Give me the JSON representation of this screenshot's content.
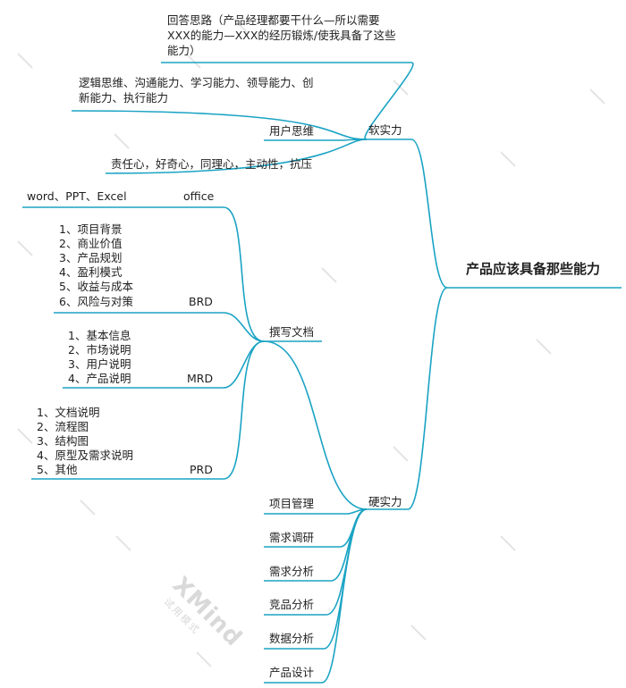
{
  "root": "产品应该具备那些能力",
  "soft": {
    "label": "软实力",
    "approach_lines": [
      "回答思路（产品经理都要干什么—所以需要",
      "XXX的能力—XXX的经历锻炼/使我具备了这些",
      "能力）"
    ],
    "abilities_lines": [
      "逻辑思维、沟通能力、学习能力、领导能力、创",
      "新能力、执行能力"
    ],
    "user_thinking": "用户思维",
    "traits": "责任心，好奇心，同理心，主动性，抗压"
  },
  "hard": {
    "label": "硬实力",
    "writing": {
      "label": "撰写文档",
      "office": {
        "label": "office",
        "items": [
          "word、PPT、Excel"
        ]
      },
      "brd": {
        "label": "BRD",
        "items": [
          "1、项目背景",
          "2、商业价值",
          "3、产品规划",
          "4、盈利模式",
          "5、收益与成本",
          "6、风险与对策"
        ]
      },
      "mrd": {
        "label": "MRD",
        "items": [
          "1、基本信息",
          "2、市场说明",
          "3、用户说明",
          "4、产品说明"
        ]
      },
      "prd": {
        "label": "PRD",
        "items": [
          "1、文档说明",
          "2、流程图",
          "3、结构图",
          "4、原型及需求说明",
          "5、其他"
        ]
      }
    },
    "others": [
      "项目管理",
      "需求调研",
      "需求分析",
      "竞品分析",
      "数据分析",
      "产品设计"
    ]
  },
  "watermark": {
    "logo": "XMind",
    "sub": "试用模式"
  },
  "colors": {
    "line": "#1aa3c4",
    "text": "#1f1f1f",
    "watermark": "#d9d9d9"
  }
}
